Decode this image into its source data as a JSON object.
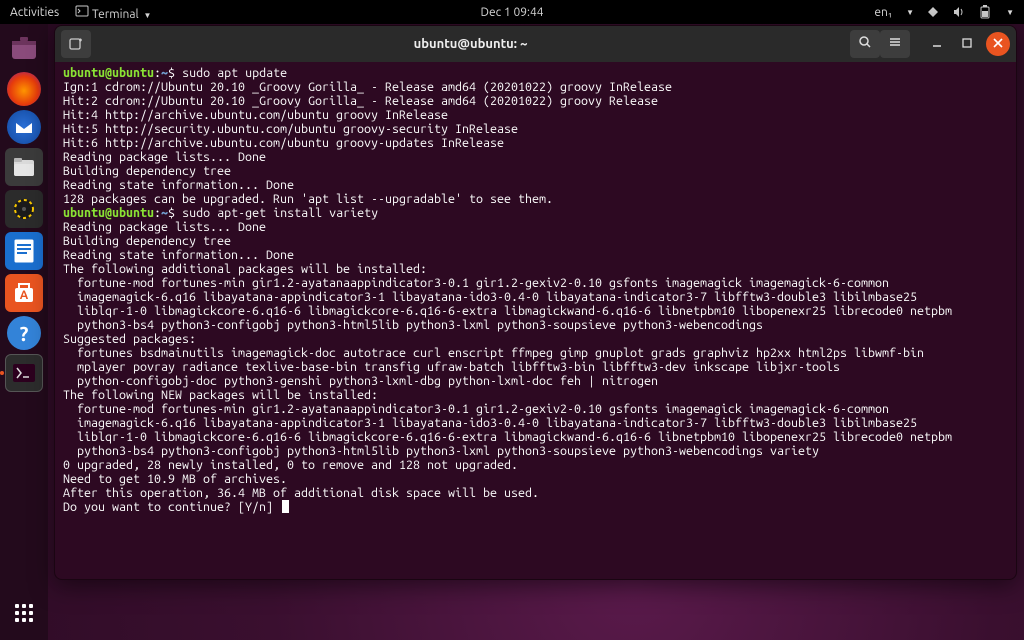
{
  "gnome": {
    "activities": "Activities",
    "app_menu": "Terminal",
    "datetime": "Dec 1  09:44",
    "lang": "en₁"
  },
  "dock": {
    "items": [
      {
        "name": "firefox"
      },
      {
        "name": "thunderbird"
      },
      {
        "name": "files"
      },
      {
        "name": "rhythmbox"
      },
      {
        "name": "libreoffice-writer"
      },
      {
        "name": "ubuntu-software"
      },
      {
        "name": "help"
      },
      {
        "name": "terminal"
      }
    ]
  },
  "terminal_window": {
    "title": "ubuntu@ubuntu: ~"
  },
  "session": {
    "prompt_user_host": "ubuntu@ubuntu",
    "prompt_cwd": "~",
    "prompt_suffix": "$ ",
    "cmd1": "sudo apt update",
    "out1": [
      "Ign:1 cdrom://Ubuntu 20.10 _Groovy Gorilla_ - Release amd64 (20201022) groovy InRelease",
      "Hit:2 cdrom://Ubuntu 20.10 _Groovy Gorilla_ - Release amd64 (20201022) groovy Release",
      "Hit:4 http://archive.ubuntu.com/ubuntu groovy InRelease",
      "Hit:5 http://security.ubuntu.com/ubuntu groovy-security InRelease",
      "Hit:6 http://archive.ubuntu.com/ubuntu groovy-updates InRelease",
      "Reading package lists... Done",
      "Building dependency tree",
      "Reading state information... Done",
      "128 packages can be upgraded. Run 'apt list --upgradable' to see them."
    ],
    "cmd2": "sudo apt-get install variety",
    "out2": [
      "Reading package lists... Done",
      "Building dependency tree",
      "Reading state information... Done",
      "The following additional packages will be installed:",
      "  fortune-mod fortunes-min gir1.2-ayatanaappindicator3-0.1 gir1.2-gexiv2-0.10 gsfonts imagemagick imagemagick-6-common",
      "  imagemagick-6.q16 libayatana-appindicator3-1 libayatana-ido3-0.4-0 libayatana-indicator3-7 libfftw3-double3 libilmbase25",
      "  liblqr-1-0 libmagickcore-6.q16-6 libmagickcore-6.q16-6-extra libmagickwand-6.q16-6 libnetpbm10 libopenexr25 librecode0 netpbm",
      "  python3-bs4 python3-configobj python3-html5lib python3-lxml python3-soupsieve python3-webencodings",
      "Suggested packages:",
      "  fortunes bsdmainutils imagemagick-doc autotrace curl enscript ffmpeg gimp gnuplot grads graphviz hp2xx html2ps libwmf-bin",
      "  mplayer povray radiance texlive-base-bin transfig ufraw-batch libfftw3-bin libfftw3-dev inkscape libjxr-tools",
      "  python-configobj-doc python3-genshi python3-lxml-dbg python-lxml-doc feh | nitrogen",
      "The following NEW packages will be installed:",
      "  fortune-mod fortunes-min gir1.2-ayatanaappindicator3-0.1 gir1.2-gexiv2-0.10 gsfonts imagemagick imagemagick-6-common",
      "  imagemagick-6.q16 libayatana-appindicator3-1 libayatana-ido3-0.4-0 libayatana-indicator3-7 libfftw3-double3 libilmbase25",
      "  liblqr-1-0 libmagickcore-6.q16-6 libmagickcore-6.q16-6-extra libmagickwand-6.q16-6 libnetpbm10 libopenexr25 librecode0 netpbm",
      "  python3-bs4 python3-configobj python3-html5lib python3-lxml python3-soupsieve python3-webencodings variety",
      "0 upgraded, 28 newly installed, 0 to remove and 128 not upgraded.",
      "Need to get 10.9 MB of archives.",
      "After this operation, 36.4 MB of additional disk space will be used.",
      "Do you want to continue? [Y/n] "
    ]
  }
}
